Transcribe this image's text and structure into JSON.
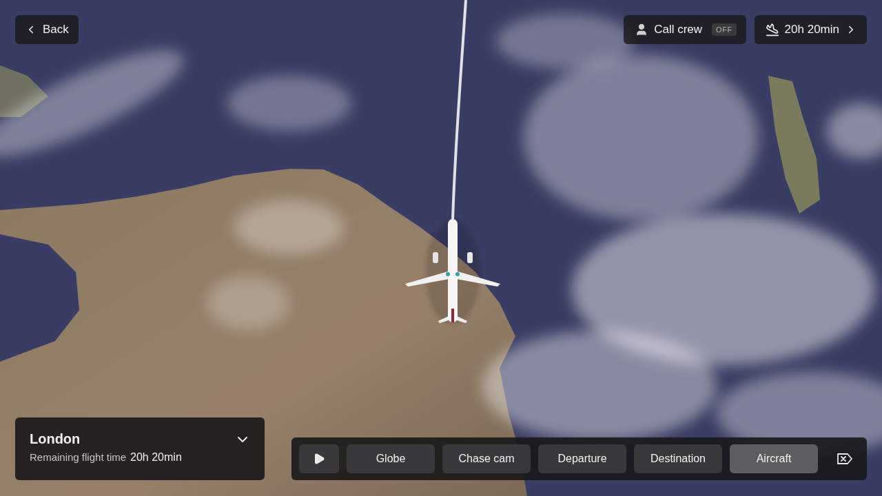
{
  "back_button": {
    "label": "Back"
  },
  "call_crew": {
    "label": "Call crew",
    "badge": "OFF",
    "on": false
  },
  "flight_time_button": {
    "label": "20h 20min"
  },
  "destination_card": {
    "title": "London",
    "subtitle": "Remaining flight time",
    "time": "20h 20min",
    "expanded": false
  },
  "view_toolbar": {
    "playing": false,
    "views": [
      {
        "label": "Globe",
        "selected": false
      },
      {
        "label": "Chase cam",
        "selected": false
      },
      {
        "label": "Departure",
        "selected": false
      },
      {
        "label": "Destination",
        "selected": false
      },
      {
        "label": "Aircraft",
        "selected": true
      }
    ]
  }
}
